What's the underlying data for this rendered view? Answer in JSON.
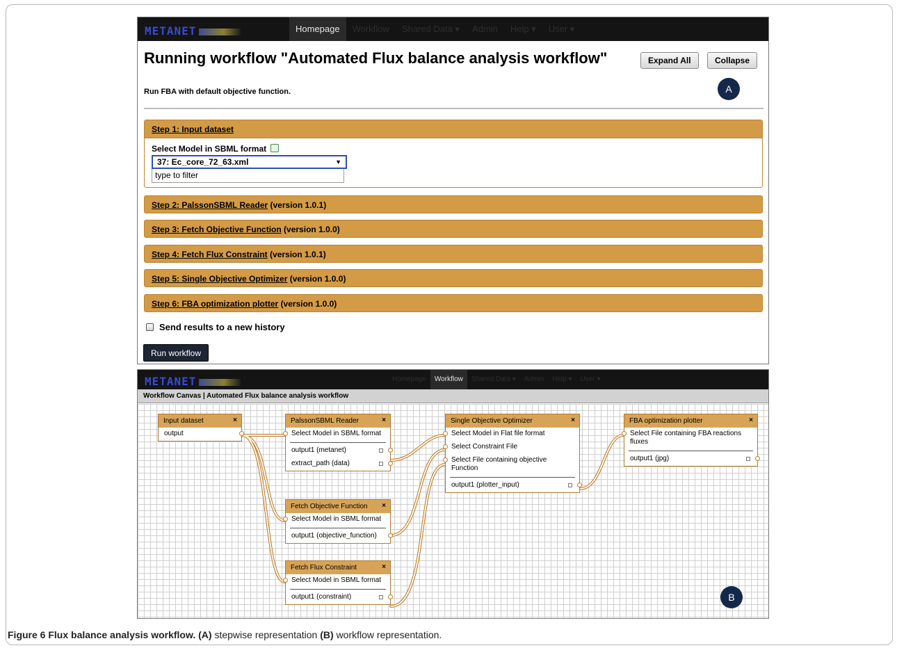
{
  "panel_a": {
    "nav": {
      "items": [
        "Homepage",
        "Workflow",
        "Shared Data ▾",
        "Admin",
        "Help ▾",
        "User ▾"
      ],
      "active": "Homepage"
    },
    "title": "Running workflow \"Automated Flux balance analysis workflow\"",
    "subtitle": "Run FBA with default objective function.",
    "expand_all": "Expand All",
    "collapse": "Collapse",
    "badge": "A",
    "step1": {
      "label": "Step 1: Input dataset",
      "select_label": "Select Model in SBML format",
      "selected": "37: Ec_core_72_63.xml",
      "filter_placeholder": "type to filter"
    },
    "steps": [
      {
        "label": "Step 2: PalssonSBML Reader",
        "version": "(version 1.0.1)"
      },
      {
        "label": "Step 3: Fetch Objective Function",
        "version": "(version 1.0.0)"
      },
      {
        "label": "Step 4: Fetch Flux Constraint",
        "version": "(version 1.0.1)"
      },
      {
        "label": "Step 5: Single Objective Optimizer",
        "version": "(version 1.0.0)"
      },
      {
        "label": "Step 6: FBA optimization plotter",
        "version": "(version 1.0.0)"
      }
    ],
    "checkbox_label": "Send results to a new history",
    "run_button": "Run workflow"
  },
  "panel_b": {
    "nav": {
      "items": [
        "Homepage",
        "Workflow",
        "Shared Data ▾",
        "Admin",
        "Help ▾",
        "User ▾"
      ],
      "active": "Workflow"
    },
    "canvas_title": "Workflow Canvas | Automated Flux balance analysis workflow",
    "badge": "B",
    "nodes": {
      "input": {
        "title": "Input dataset",
        "outputs": [
          "output"
        ]
      },
      "reader": {
        "title": "PalssonSBML Reader",
        "inputs": [
          "Select Model in SBML format"
        ],
        "outputs": [
          "output1 (metanet)",
          "extract_path (data)"
        ]
      },
      "objective": {
        "title": "Fetch Objective Function",
        "inputs": [
          "Select Model in SBML format"
        ],
        "outputs": [
          "output1 (objective_function)"
        ]
      },
      "constraint": {
        "title": "Fetch Flux Constraint",
        "inputs": [
          "Select Model in SBML format"
        ],
        "outputs": [
          "output1 (constraint)"
        ]
      },
      "optimizer": {
        "title": "Single Objective Optimizer",
        "inputs": [
          "Select Model in Flat file format",
          "Select Constraint File",
          "Select File containing objective Function"
        ],
        "outputs": [
          "output1 (plotter_input)"
        ]
      },
      "plotter": {
        "title": "FBA optimization plotter",
        "inputs": [
          "Select File containing FBA reactions fluxes"
        ],
        "outputs": [
          "output1 (jpg)"
        ]
      }
    }
  },
  "caption": {
    "label": "Figure 6",
    "title": "Flux balance analysis workflow.",
    "a_mark": "(A)",
    "a_text": "stepwise representation",
    "b_mark": "(B)",
    "b_text": "workflow representation."
  },
  "colors": {
    "step_bg": "#d39b46",
    "node_title_bg": "#d7a457",
    "navbar": "#141414",
    "badge": "#16284a"
  }
}
